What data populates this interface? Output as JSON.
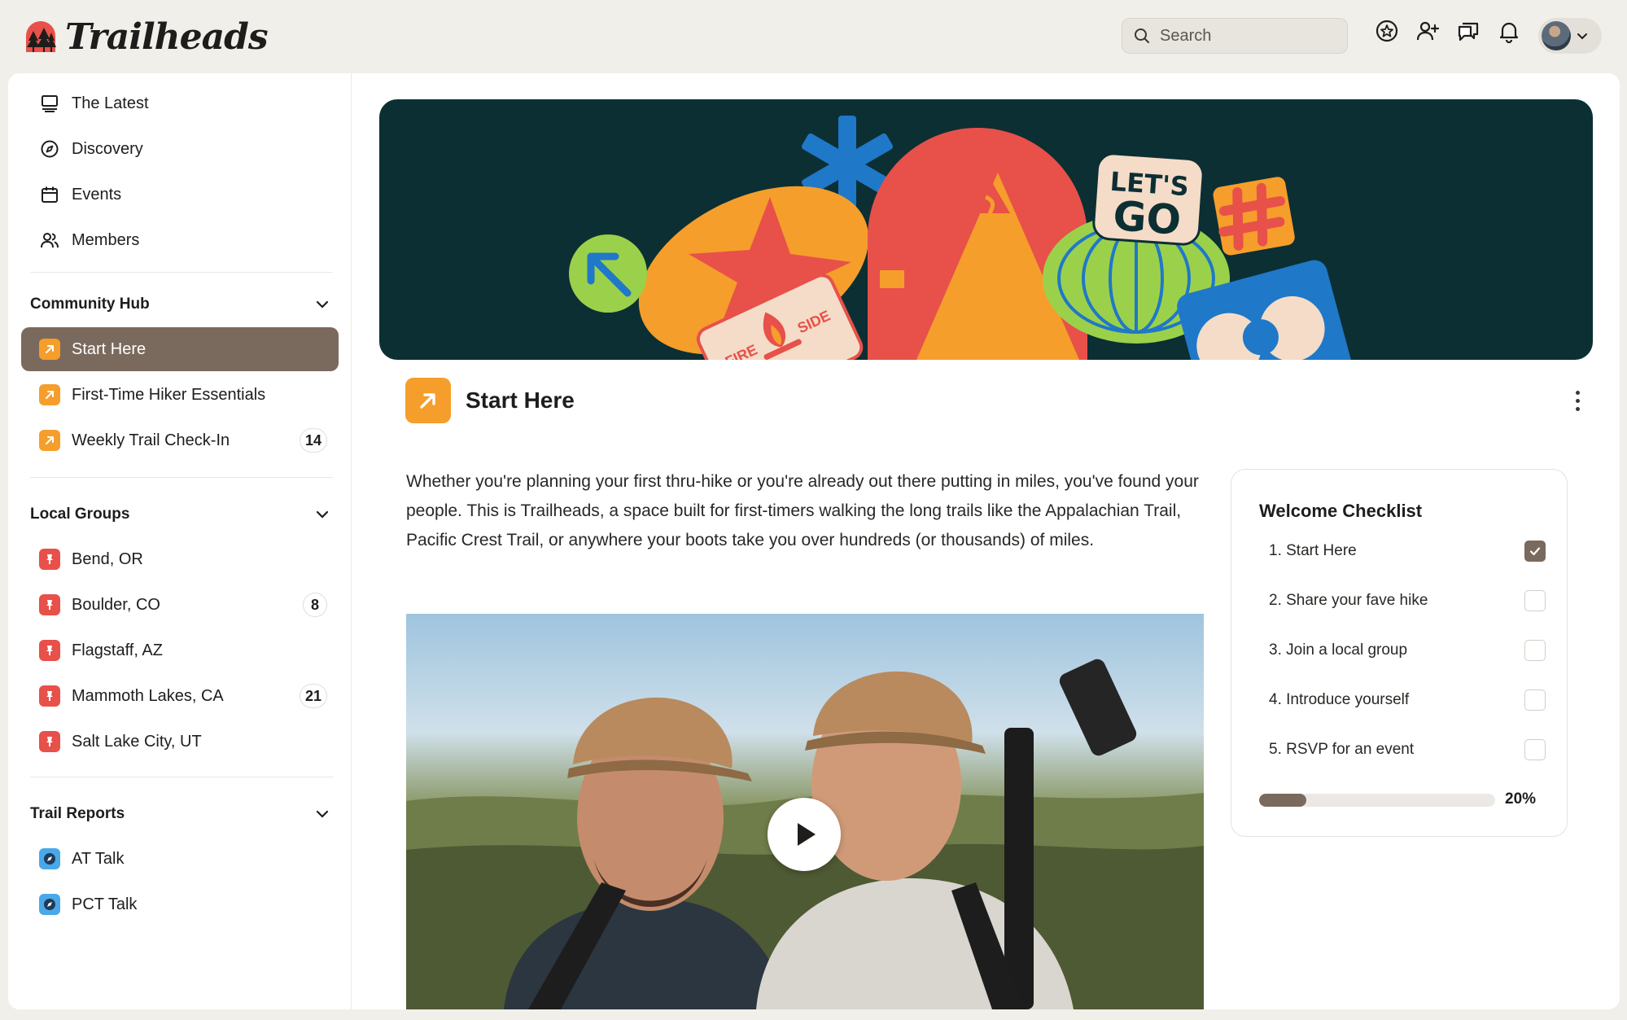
{
  "app": {
    "name": "Trailheads"
  },
  "search": {
    "placeholder": "Search"
  },
  "header_icons": [
    "star-badge-icon",
    "add-user-icon",
    "chat-icon",
    "bell-icon"
  ],
  "sidebar": {
    "main_items": [
      {
        "label": "The Latest",
        "icon": "monitor-icon"
      },
      {
        "label": "Discovery",
        "icon": "compass-icon"
      },
      {
        "label": "Events",
        "icon": "calendar-icon"
      },
      {
        "label": "Members",
        "icon": "members-icon"
      }
    ],
    "sections": [
      {
        "title": "Community Hub",
        "items": [
          {
            "label": "Start Here",
            "active": true,
            "icon": "arrow-up-right-icon"
          },
          {
            "label": "First-Time Hiker Essentials",
            "icon": "arrow-up-right-icon"
          },
          {
            "label": "Weekly Trail Check-In",
            "badge": "14",
            "icon": "arrow-up-right-icon"
          }
        ]
      },
      {
        "title": "Local Groups",
        "items": [
          {
            "label": "Bend, OR",
            "icon": "pin-icon"
          },
          {
            "label": "Boulder, CO",
            "badge": "8",
            "icon": "pin-icon"
          },
          {
            "label": "Flagstaff, AZ",
            "icon": "pin-icon"
          },
          {
            "label": "Mammoth Lakes, CA",
            "badge": "21",
            "icon": "pin-icon"
          },
          {
            "label": "Salt Lake City, UT",
            "icon": "pin-icon"
          }
        ]
      },
      {
        "title": "Trail Reports",
        "items": [
          {
            "label": "AT Talk",
            "icon": "compass-icon"
          },
          {
            "label": "PCT Talk",
            "icon": "compass-icon"
          }
        ]
      }
    ]
  },
  "banner": {
    "sticker_text_1": "LET'S",
    "sticker_text_2": "GO",
    "badge_text_1": "FIRE",
    "badge_text_2": "SIDE"
  },
  "page": {
    "title": "Start Here",
    "intro": "Whether you're planning your first thru-hike or you're already out there putting in miles, you've found your people. This is Trailheads, a space built for first-timers walking the long trails like the Appalachian Trail, Pacific Crest Trail, or anywhere your boots take you over hundreds (or thousands) of miles."
  },
  "checklist": {
    "title": "Welcome Checklist",
    "items": [
      {
        "label": "1. Start Here",
        "checked": true
      },
      {
        "label": "2. Share your fave hike",
        "checked": false
      },
      {
        "label": "3. Join a local group",
        "checked": false
      },
      {
        "label": "4. Introduce yourself",
        "checked": false
      },
      {
        "label": "5. RSVP for an event",
        "checked": false
      }
    ],
    "progress_percent": 20,
    "progress_label": "20%"
  },
  "colors": {
    "accent_brown": "#7a6a5d",
    "orange": "#f59e2b",
    "red": "#e8504a",
    "blue": "#4aa8e8",
    "banner_bg": "#0c2f33"
  }
}
